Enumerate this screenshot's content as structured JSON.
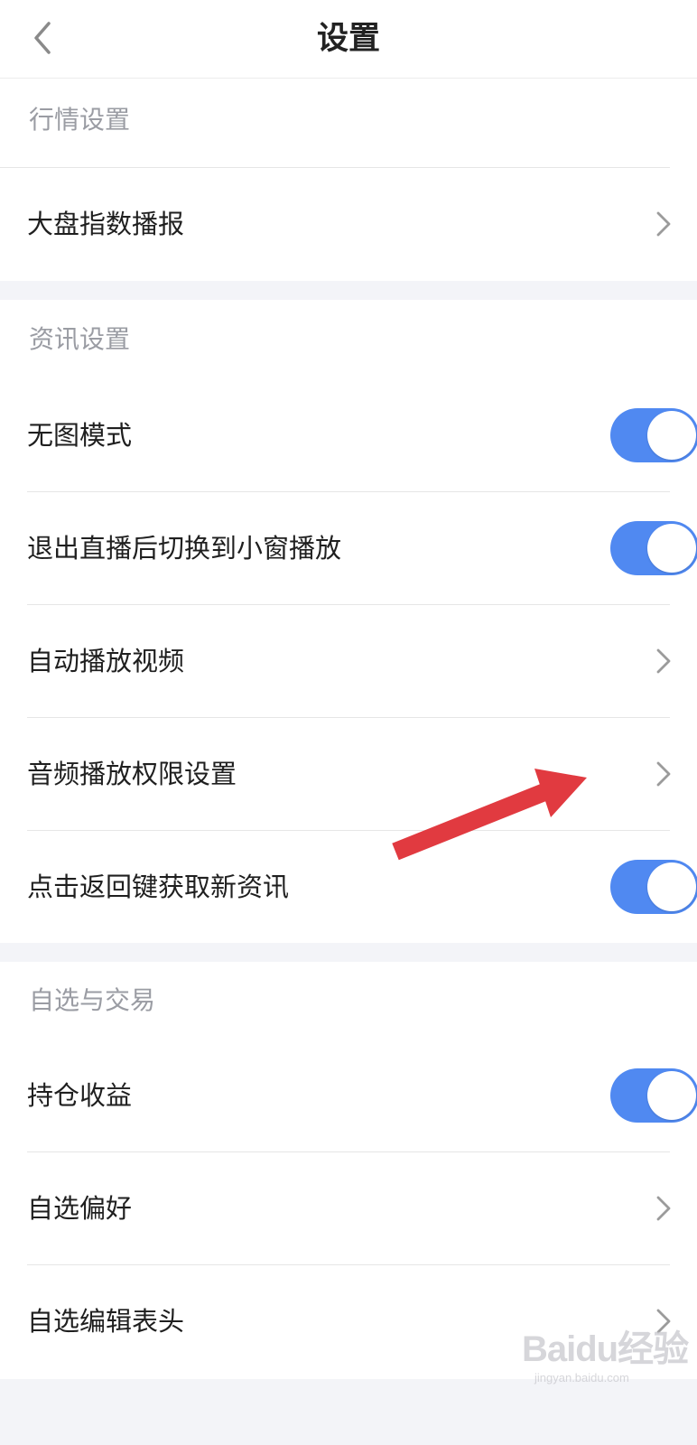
{
  "header": {
    "title": "设置",
    "back_icon": "chevron-left-icon"
  },
  "sections": [
    {
      "title": "行情设置",
      "rows": [
        {
          "label": "大盘指数播报",
          "control": "chevron"
        }
      ]
    },
    {
      "title": "资讯设置",
      "rows": [
        {
          "label": "无图模式",
          "control": "toggle",
          "on": true
        },
        {
          "label": "退出直播后切换到小窗播放",
          "control": "toggle",
          "on": true
        },
        {
          "label": "自动播放视频",
          "control": "chevron"
        },
        {
          "label": "音频播放权限设置",
          "control": "chevron"
        },
        {
          "label": "点击返回键获取新资讯",
          "control": "toggle",
          "on": true
        }
      ]
    },
    {
      "title": "自选与交易",
      "rows": [
        {
          "label": "持仓收益",
          "control": "toggle",
          "on": true
        },
        {
          "label": "自选偏好",
          "control": "chevron"
        },
        {
          "label": "自选编辑表头",
          "control": "chevron"
        }
      ]
    }
  ],
  "watermark": {
    "logo": "Baidu经验",
    "url": "jingyan.baidu.com"
  },
  "colors": {
    "toggle_on": "#5089f1",
    "page_bg": "#f3f4f8",
    "section_title": "#9a9ca3",
    "annotation_arrow": "#e13a40"
  }
}
